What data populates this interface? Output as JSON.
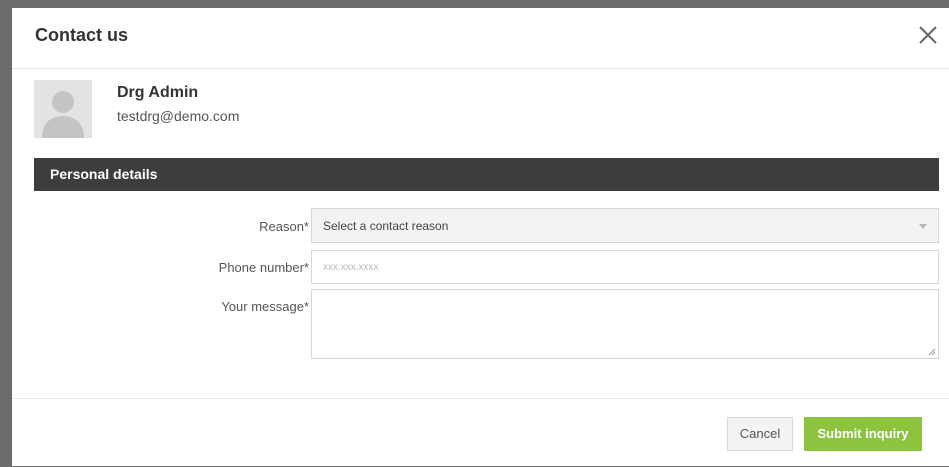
{
  "modal": {
    "title": "Contact us",
    "close_icon": "close-icon"
  },
  "user": {
    "name": "Drg Admin",
    "email": "testdrg@demo.com",
    "avatar_icon": "user-avatar-icon"
  },
  "section": {
    "title": "Personal details"
  },
  "form": {
    "reason_label": "Reason*",
    "reason_value": "Select a contact reason",
    "phone_label": "Phone number*",
    "phone_placeholder": "xxx.xxx.xxxx",
    "message_label": "Your message*"
  },
  "footer": {
    "cancel_label": "Cancel",
    "submit_label": "Submit inquiry"
  },
  "colors": {
    "section_bar": "#3d3d3d",
    "submit_button": "#8dc43f",
    "backdrop": "#6b6b6b"
  }
}
